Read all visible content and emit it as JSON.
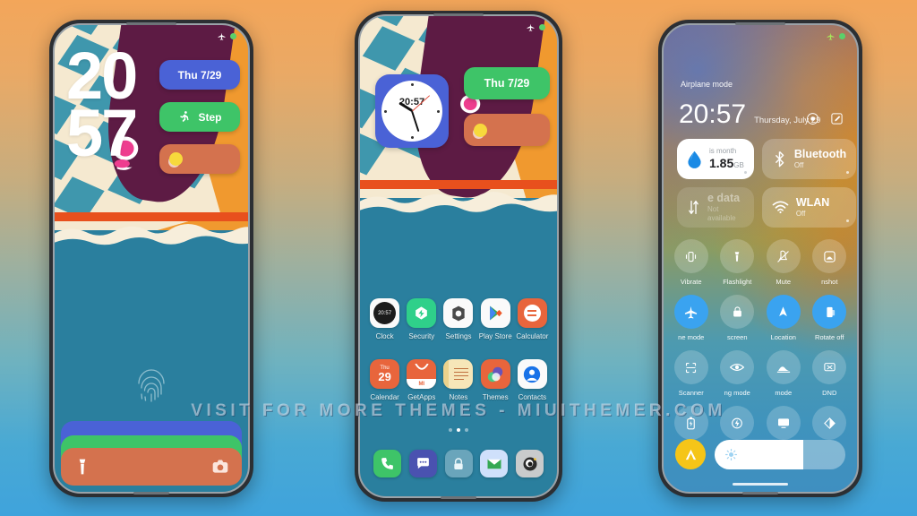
{
  "background": {
    "top_color": "#f3a65a",
    "bottom_color": "#3fa3dc"
  },
  "watermark": {
    "text": "VISIT  FOR  MORE  THEMES  -  MIUITHEMER.COM"
  },
  "phone1": {
    "name": "lockscreen",
    "statusbar": {
      "airplane_icon": "airplane-icon",
      "battery_icon": "battery-icon"
    },
    "lock_clock": {
      "hours": "20",
      "minutes": "57"
    },
    "widgets": [
      {
        "id": "date",
        "label": "Thu  7/29",
        "icon": "calendar-icon",
        "color": "#4a62d6"
      },
      {
        "id": "step",
        "label": "Step",
        "icon": "running-icon",
        "color": "#3ec468"
      },
      {
        "id": "weather",
        "label": "",
        "icon": "sun-icon",
        "color": "#d4724e"
      }
    ],
    "fingerprint": {
      "icon": "fingerprint-icon"
    },
    "bottom_bars": [
      {
        "id": "bar-blue",
        "color": "#4a62d6"
      },
      {
        "id": "bar-green",
        "color": "#3ec468"
      },
      {
        "id": "bar-orange",
        "color": "#d4724e"
      }
    ],
    "shortcuts": {
      "left_icon": "flashlight-icon",
      "right_icon": "camera-icon"
    }
  },
  "phone2": {
    "name": "homescreen",
    "statusbar": {
      "airplane_icon": "airplane-icon",
      "battery_icon": "battery-icon"
    },
    "clock_widget": {
      "time": "20:57",
      "icon": "analog-clock-icon"
    },
    "widgets": [
      {
        "id": "date",
        "label": "Thu 7/29",
        "color": "#3ec468"
      },
      {
        "id": "weather",
        "label": "",
        "icon": "sun-icon",
        "color": "#d4724e"
      }
    ],
    "apps_row1": [
      {
        "label": "Clock",
        "icon": "clock-icon",
        "value": "20:57"
      },
      {
        "label": "Security",
        "icon": "security-icon"
      },
      {
        "label": "Settings",
        "icon": "settings-icon"
      },
      {
        "label": "Play Store",
        "icon": "play-store-icon"
      },
      {
        "label": "Calculator",
        "icon": "calculator-icon"
      }
    ],
    "apps_row2": [
      {
        "label": "Calendar",
        "icon": "calendar-icon",
        "day_name": "Thu",
        "day_num": "29"
      },
      {
        "label": "GetApps",
        "icon": "getapps-icon",
        "badge": "MI"
      },
      {
        "label": "Notes",
        "icon": "notes-icon"
      },
      {
        "label": "Themes",
        "icon": "themes-icon"
      },
      {
        "label": "Contacts",
        "icon": "contacts-icon"
      }
    ],
    "page_dots": {
      "count": 3,
      "active": 1
    },
    "dock": [
      {
        "label": "Phone",
        "icon": "phone-icon"
      },
      {
        "label": "Messages",
        "icon": "messages-icon"
      },
      {
        "label": "Security",
        "icon": "lock-icon"
      },
      {
        "label": "Email",
        "icon": "email-icon"
      },
      {
        "label": "Camera",
        "icon": "camera-icon"
      }
    ]
  },
  "phone3": {
    "name": "control-center",
    "statusbar": {
      "label": "Airplane mode",
      "airplane_icon": "airplane-icon",
      "battery_icon": "battery-icon"
    },
    "clock": {
      "time": "20:57",
      "date": "Thursday, July 29"
    },
    "actions": [
      {
        "id": "settings-record",
        "icon": "record-icon"
      },
      {
        "id": "edit",
        "icon": "edit-icon"
      }
    ],
    "big_tiles": [
      {
        "id": "data-usage",
        "style": "light",
        "icon": "data-drop-icon",
        "caption": "is month",
        "value": "1.85",
        "unit": "GB"
      },
      {
        "id": "bluetooth",
        "style": "tint",
        "icon": "bluetooth-icon",
        "title": "Bluetooth",
        "status": "Off"
      },
      {
        "id": "mobile-data",
        "style": "dim",
        "icon": "data-arrows-icon",
        "title": "e data",
        "status": "Not available"
      },
      {
        "id": "wlan",
        "style": "tint",
        "icon": "wifi-icon",
        "title": "WLAN",
        "status": "Off"
      }
    ],
    "toggles": [
      {
        "label": "Vibrate",
        "icon": "vibrate-icon",
        "on": false
      },
      {
        "label": "Flashlight",
        "icon": "flashlight-icon",
        "on": false
      },
      {
        "label": "Mute",
        "icon": "mute-icon",
        "on": false
      },
      {
        "label": "nshot",
        "icon": "screenshot-icon",
        "on": false
      },
      {
        "label": "ne mode",
        "icon": "airplane-icon",
        "on": true
      },
      {
        "label": "screen",
        "icon": "lockscreen-icon",
        "on": false
      },
      {
        "label": "Location",
        "icon": "location-icon",
        "on": true
      },
      {
        "label": "Rotate off",
        "icon": "rotate-icon",
        "on": true
      },
      {
        "label": "Scanner",
        "icon": "scanner-icon",
        "on": false
      },
      {
        "label": "ng mode",
        "icon": "reading-mode-icon",
        "on": false
      },
      {
        "label": "mode",
        "icon": "dark-mode-icon",
        "on": false
      },
      {
        "label": "DND",
        "icon": "dnd-icon",
        "on": false
      },
      {
        "label": "",
        "icon": "battery-saver-icon",
        "on": false
      },
      {
        "label": "",
        "icon": "quick-charge-icon",
        "on": false
      },
      {
        "label": "",
        "icon": "cast-icon",
        "on": false
      },
      {
        "label": "",
        "icon": "contrast-icon",
        "on": false
      }
    ],
    "brightness": {
      "icon": "brightness-icon",
      "auto_icon": "auto-brightness-icon",
      "level_percent": 68
    }
  }
}
